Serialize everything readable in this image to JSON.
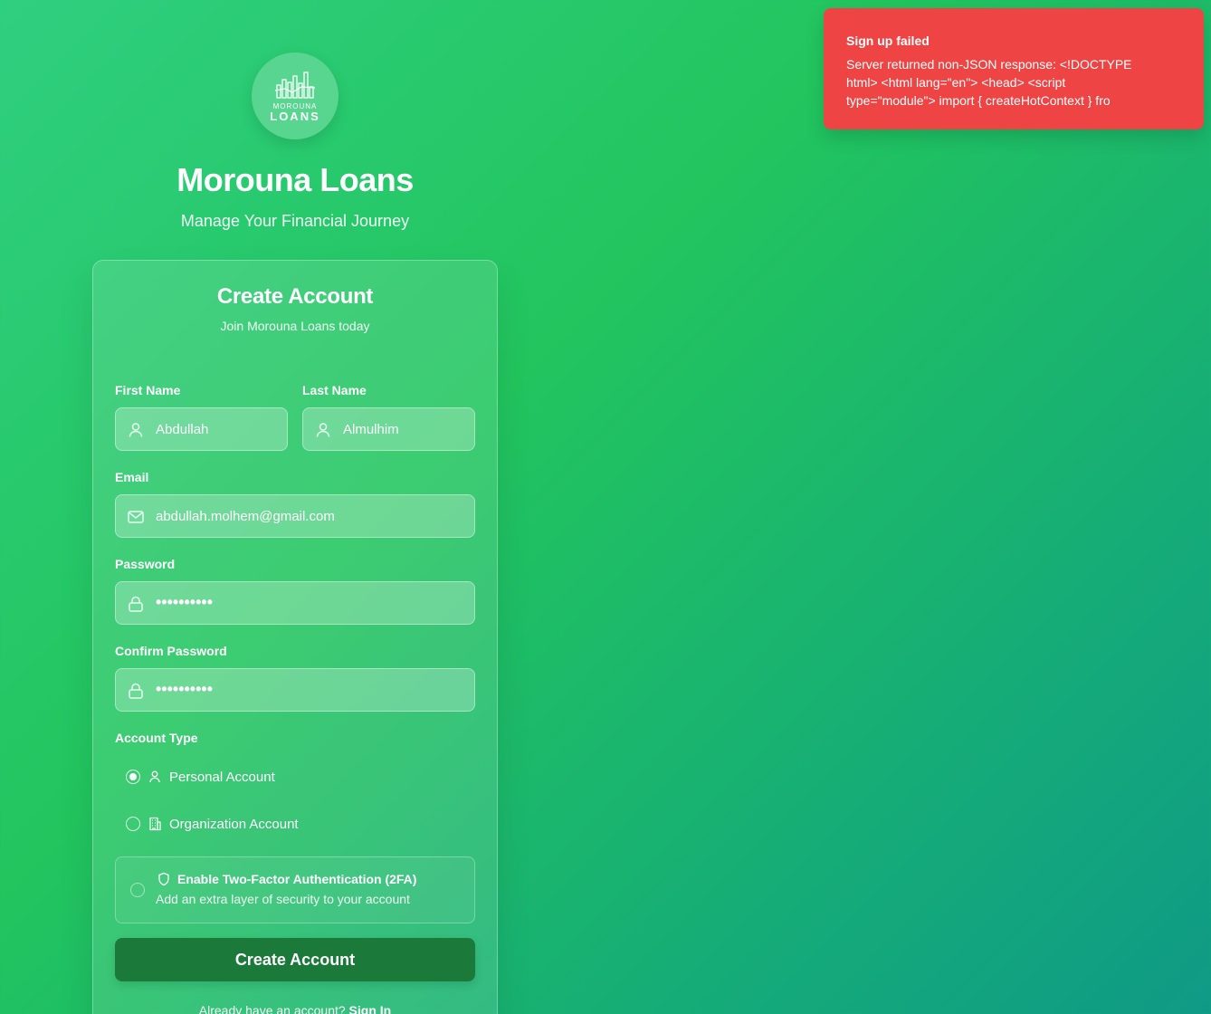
{
  "brand": {
    "logo_line1": "MOROUNA",
    "logo_line2": "LOANS",
    "title": "Morouna Loans",
    "tagline": "Manage Your Financial Journey"
  },
  "form": {
    "title": "Create Account",
    "subtitle": "Join Morouna Loans today",
    "first_name": {
      "label": "First Name",
      "value": "Abdullah",
      "icon": "user-icon"
    },
    "last_name": {
      "label": "Last Name",
      "value": "Almulhim",
      "icon": "user-icon"
    },
    "email": {
      "label": "Email",
      "value": "abdullah.molhem@gmail.com",
      "icon": "mail-icon"
    },
    "password": {
      "label": "Password",
      "masked_value": "••••••••••",
      "icon": "lock-icon"
    },
    "confirm_password": {
      "label": "Confirm Password",
      "masked_value": "••••••••••",
      "icon": "lock-icon"
    },
    "account_type": {
      "label": "Account Type",
      "options": [
        {
          "label": "Personal Account",
          "icon": "user-icon",
          "selected": true
        },
        {
          "label": "Organization Account",
          "icon": "building-icon",
          "selected": false
        }
      ]
    },
    "two_factor": {
      "title": "Enable Two-Factor Authentication (2FA)",
      "description": "Add an extra layer of security to your account",
      "icon": "shield-icon",
      "enabled": false
    },
    "submit_label": "Create Account",
    "signin_prompt": "Already have an account?",
    "signin_link": "Sign In"
  },
  "toast": {
    "title": "Sign up failed",
    "message": "Server returned non-JSON response: <!DOCTYPE html> <html lang=\"en\"> <head> <script type=\"module\"> import { createHotContext } fro",
    "color": "#ef4444"
  },
  "colors": {
    "button": "#1b7a3a",
    "background_start": "#2fcf80",
    "background_end": "#0f9a86"
  }
}
